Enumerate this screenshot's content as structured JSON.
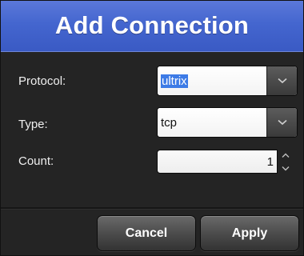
{
  "dialog": {
    "title": "Add Connection"
  },
  "form": {
    "protocol": {
      "label": "Protocol:",
      "value": "ultrix"
    },
    "type": {
      "label": "Type:",
      "value": "tcp"
    },
    "count": {
      "label": "Count:",
      "value": "1"
    }
  },
  "buttons": {
    "cancel_label": "Cancel",
    "apply_label": "Apply"
  },
  "icons": {
    "dropdown": "chevron-down-icon",
    "stepper_up": "chevron-up-icon",
    "stepper_down": "chevron-down-icon"
  },
  "colors": {
    "title_bar": "#4466cf",
    "dialog_bg": "#242424",
    "selection": "#3d7be6"
  }
}
